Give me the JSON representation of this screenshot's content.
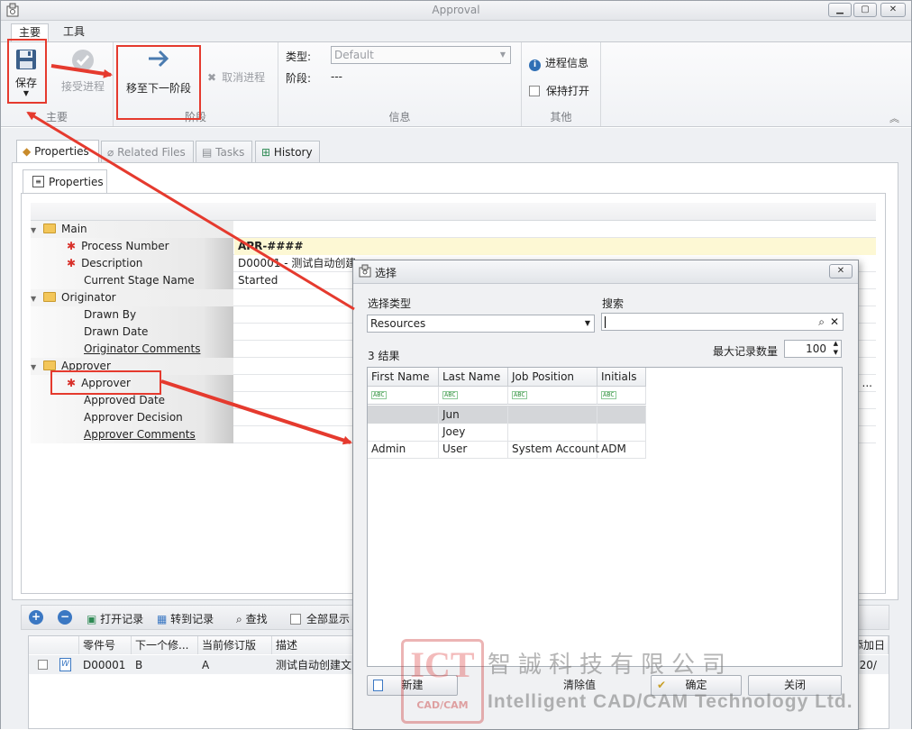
{
  "window": {
    "title": "Approval",
    "btn_min": "▁",
    "btn_max": "▢",
    "btn_close": "✕"
  },
  "ribbon_tabs": [
    "主要",
    "工具"
  ],
  "ribbon": {
    "save": "保存",
    "accept": "接受进程",
    "group_main": "主要",
    "next_stage": "移至下一阶段",
    "cancel": "取消进程",
    "group_stage": "阶段",
    "type_label": "类型:",
    "type_value": "Default",
    "stage_label": "阶段:",
    "stage_value": "---",
    "group_info": "信息",
    "process_info": "进程信息",
    "keep_open": "保持打开",
    "group_other": "其他"
  },
  "doc_tabs": [
    "Properties",
    "Related Files",
    "Tasks",
    "History"
  ],
  "subtab": "Properties",
  "properties": {
    "main": "Main",
    "process_number": "Process Number",
    "process_number_val": "APR-####",
    "description": "Description",
    "description_val": "D00001  -  测试自动创建",
    "current_stage": "Current Stage Name",
    "current_stage_val": "Started",
    "originator": "Originator",
    "drawn_by": "Drawn By",
    "drawn_date": "Drawn Date",
    "originator_comments": "Originator Comments",
    "approver_cat": "Approver",
    "approver": "Approver",
    "approver_val": "...",
    "approved_date": "Approved Date",
    "approver_decision": "Approver Decision",
    "approver_comments": "Approver Comments"
  },
  "bottom_toolbar": {
    "open_record": "打开记录",
    "goto_record": "转到记录",
    "find": "查找",
    "show_all": "全部显示"
  },
  "list": {
    "headers": [
      "零件号",
      "下一个修...",
      "当前修订版",
      "描述",
      "添加日"
    ],
    "row": {
      "part": "D00001",
      "next": "B",
      "current": "A",
      "desc": "测试自动创建文",
      "date": "020/"
    }
  },
  "dialog": {
    "title": "选择",
    "close": "✕",
    "select_type_label": "选择类型",
    "select_type_value": "Resources",
    "search_label": "搜索",
    "search_value": "",
    "results": "3 结果",
    "max_records_label": "最大记录数量",
    "max_records_value": "100",
    "columns": [
      "First Name",
      "Last Name",
      "Job Position",
      "Initials"
    ],
    "rows": [
      [
        "",
        "Jun",
        "",
        ""
      ],
      [
        "",
        "Joey",
        "",
        ""
      ],
      [
        "Admin",
        "User",
        "System Account",
        "ADM"
      ]
    ],
    "btn_new": "新建",
    "btn_clear": "清除值",
    "btn_ok": "确定",
    "btn_close": "关闭"
  },
  "watermark": {
    "ict": "ICT",
    "cad": "CAD/CAM",
    "cn": "智誠科技有限公司",
    "en": "Intelligent CAD/CAM Technology Ltd."
  },
  "colors": {
    "annotation_red": "#e53a2e",
    "selected_row": "#d4d6d9",
    "required_bg": "#fdf8d4"
  }
}
